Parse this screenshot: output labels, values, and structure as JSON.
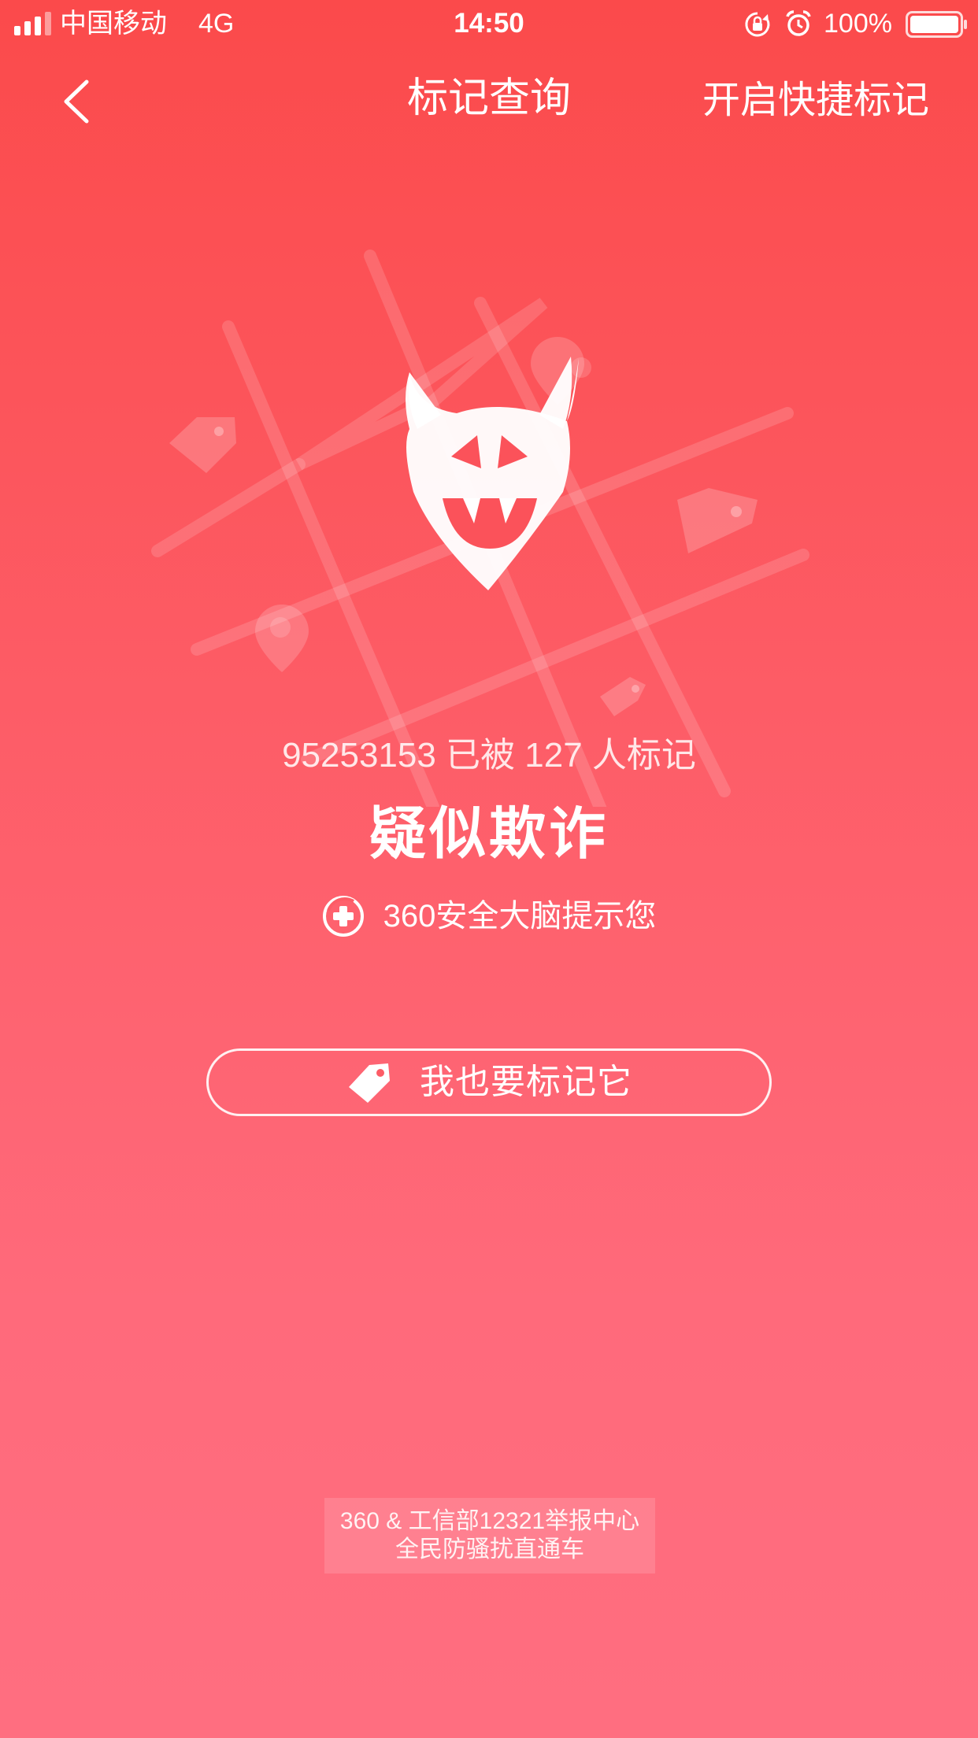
{
  "status_bar": {
    "carrier": "中国移动",
    "network": "4G",
    "time": "14:50",
    "battery": "100%",
    "icons": [
      "signal-icon",
      "rotation-lock-icon",
      "alarm-icon",
      "battery-icon"
    ]
  },
  "nav": {
    "back_icon": "back-chevron-icon",
    "title": "标记查询",
    "quick_mark": "开启快捷标记"
  },
  "result": {
    "illustration_icon": "devil-face-icon",
    "mark_count": "95253153 已被 127 人标记",
    "verdict": "疑似欺诈",
    "hint_icon": "360-plus-icon",
    "hint": "360安全大脑提示您"
  },
  "actions": {
    "mark_icon": "tag-icon",
    "mark_label": "我也要标记它"
  },
  "footer": {
    "line1": "360 & 工信部12321举报中心",
    "line2": "全民防骚扰直通车"
  },
  "colors": {
    "background_top": "#fb4a4b",
    "background_bottom": "#ff6e80",
    "foreground": "#ffffff"
  }
}
